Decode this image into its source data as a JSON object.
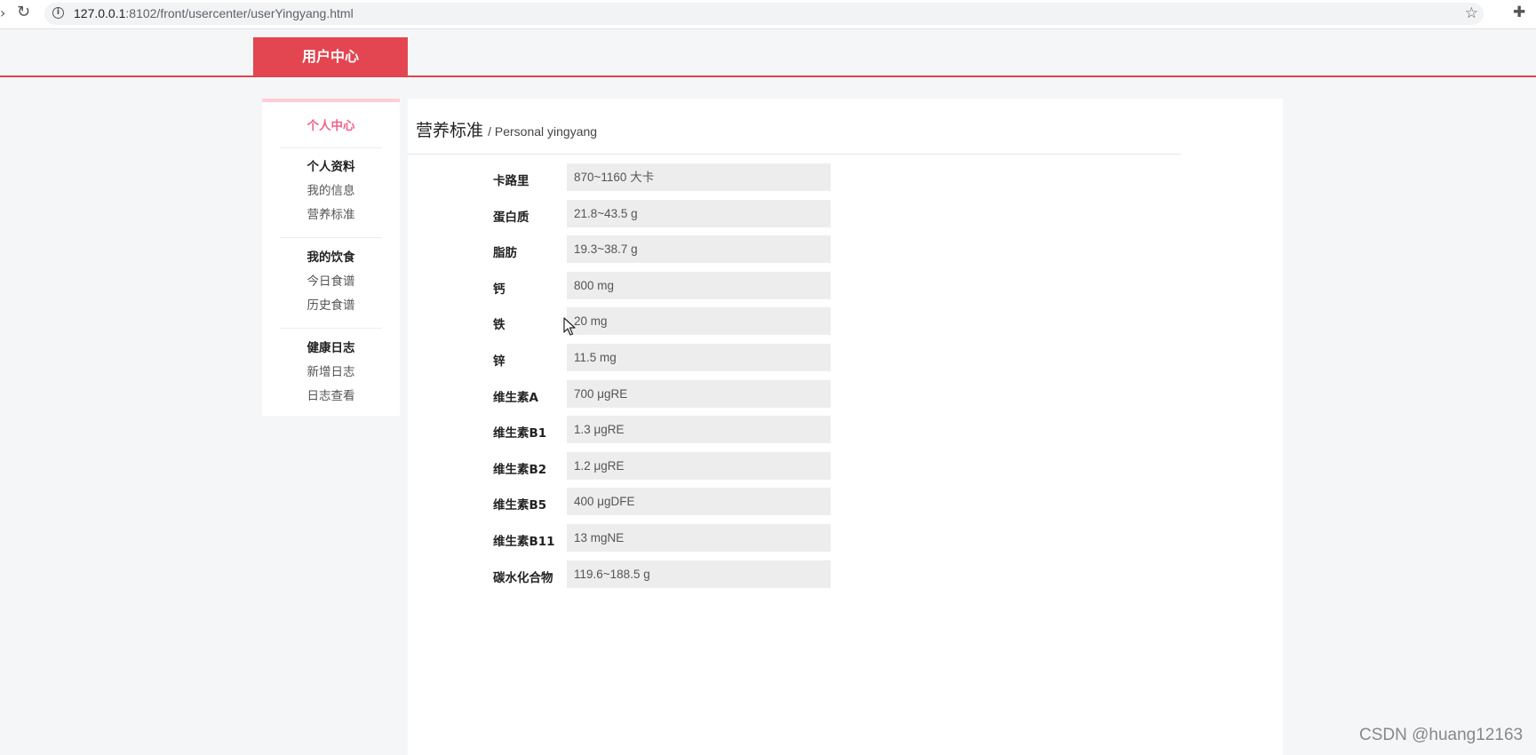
{
  "browser": {
    "url_host": "127.0.0.1",
    "url_rest": ":8102/front/usercenter/userYingyang.html"
  },
  "header": {
    "tab_label": "用户中心"
  },
  "sidebar": {
    "home": "个人中心",
    "groups": [
      {
        "title": "个人资料",
        "items": [
          "我的信息",
          "营养标准"
        ]
      },
      {
        "title": "我的饮食",
        "items": [
          "今日食谱",
          "历史食谱"
        ]
      },
      {
        "title": "健康日志",
        "items": [
          "新增日志",
          "日志查看"
        ]
      }
    ]
  },
  "main": {
    "title": "营养标准",
    "subtitle": "/ Personal yingyang",
    "rows": [
      {
        "label": "卡路里",
        "value": "870~1160 大卡"
      },
      {
        "label": "蛋白质",
        "value": "21.8~43.5 g"
      },
      {
        "label": "脂肪",
        "value": "19.3~38.7 g"
      },
      {
        "label": "钙",
        "value": "800 mg"
      },
      {
        "label": "铁",
        "value": "20 mg"
      },
      {
        "label": "锌",
        "value": "11.5 mg"
      },
      {
        "label": "维生素A",
        "value": "700 μgRE"
      },
      {
        "label": "维生素B1",
        "value": "1.3 μgRE"
      },
      {
        "label": "维生素B2",
        "value": "1.2 μgRE"
      },
      {
        "label": "维生素B5",
        "value": "400 μgDFE"
      },
      {
        "label": "维生素B11",
        "value": "13 mgNE"
      },
      {
        "label": "碳水化合物",
        "value": "119.6~188.5 g"
      }
    ]
  },
  "watermark": "CSDN @huang12163",
  "colors": {
    "accent": "#e34650",
    "sidebar_home": "#f06288",
    "sidebar_top_border": "#ffcdd5",
    "field_bg": "#ededed",
    "page_bg": "#f5f6f8"
  }
}
